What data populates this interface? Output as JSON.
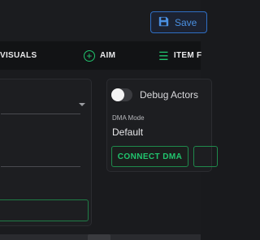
{
  "header": {
    "save_label": "Save"
  },
  "nav": {
    "items": [
      {
        "label": "VISUALS"
      },
      {
        "label": "AIM",
        "icon": "plus-circle-icon"
      },
      {
        "label": "ITEM F",
        "icon": "checklist-icon"
      }
    ]
  },
  "settings": {
    "debug_actors_label": "Debug Actors",
    "debug_actors_enabled": false,
    "dma_mode_label": "DMA Mode",
    "dma_mode_value": "Default",
    "connect_label": "CONNECT DMA"
  },
  "colors": {
    "accent_green": "#21c56e",
    "accent_blue": "#4a90e2",
    "background": "#1a1b1e"
  }
}
